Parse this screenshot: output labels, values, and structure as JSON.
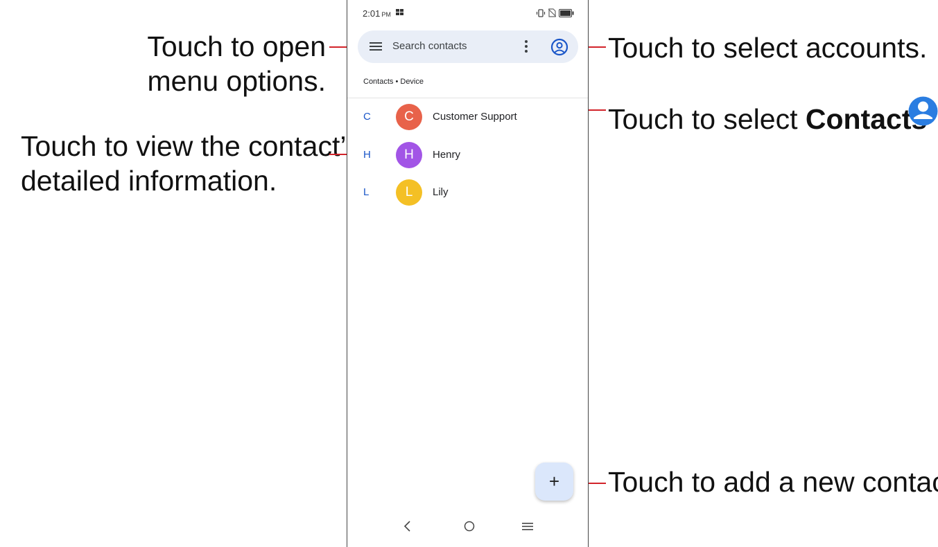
{
  "callouts": {
    "open_menu": [
      "Touch to open",
      "menu options."
    ],
    "view_contact": [
      "Touch to view the contact’s",
      "detailed information."
    ],
    "select_accounts": "Touch to select accounts.",
    "select_contacts_prefix": "Touch to select ",
    "select_contacts_bold": "Contacts",
    "add_contact": "Touch to add a new contact."
  },
  "status_bar": {
    "time": "2:01",
    "ampm": "PM"
  },
  "search": {
    "placeholder": "Search contacts"
  },
  "subheader": "Contacts • Device",
  "contacts": [
    {
      "index_letter": "C",
      "initial": "C",
      "name": "Customer Support",
      "avatar_color": "#e8624a"
    },
    {
      "index_letter": "H",
      "initial": "H",
      "name": "Henry",
      "avatar_color": "#a255e6"
    },
    {
      "index_letter": "L",
      "initial": "L",
      "name": "Lily",
      "avatar_color": "#f4c025"
    }
  ],
  "fab": {
    "icon": "plus-icon",
    "label": "+"
  },
  "navigation": {
    "back": "back-icon",
    "home": "home-icon",
    "recents": "recents-icon"
  },
  "colors": {
    "leader_line": "#d2232a",
    "search_bar_bg": "#e9eef7",
    "accent_blue": "#1a56c8",
    "contacts_icon_blue": "#2a7de1"
  }
}
